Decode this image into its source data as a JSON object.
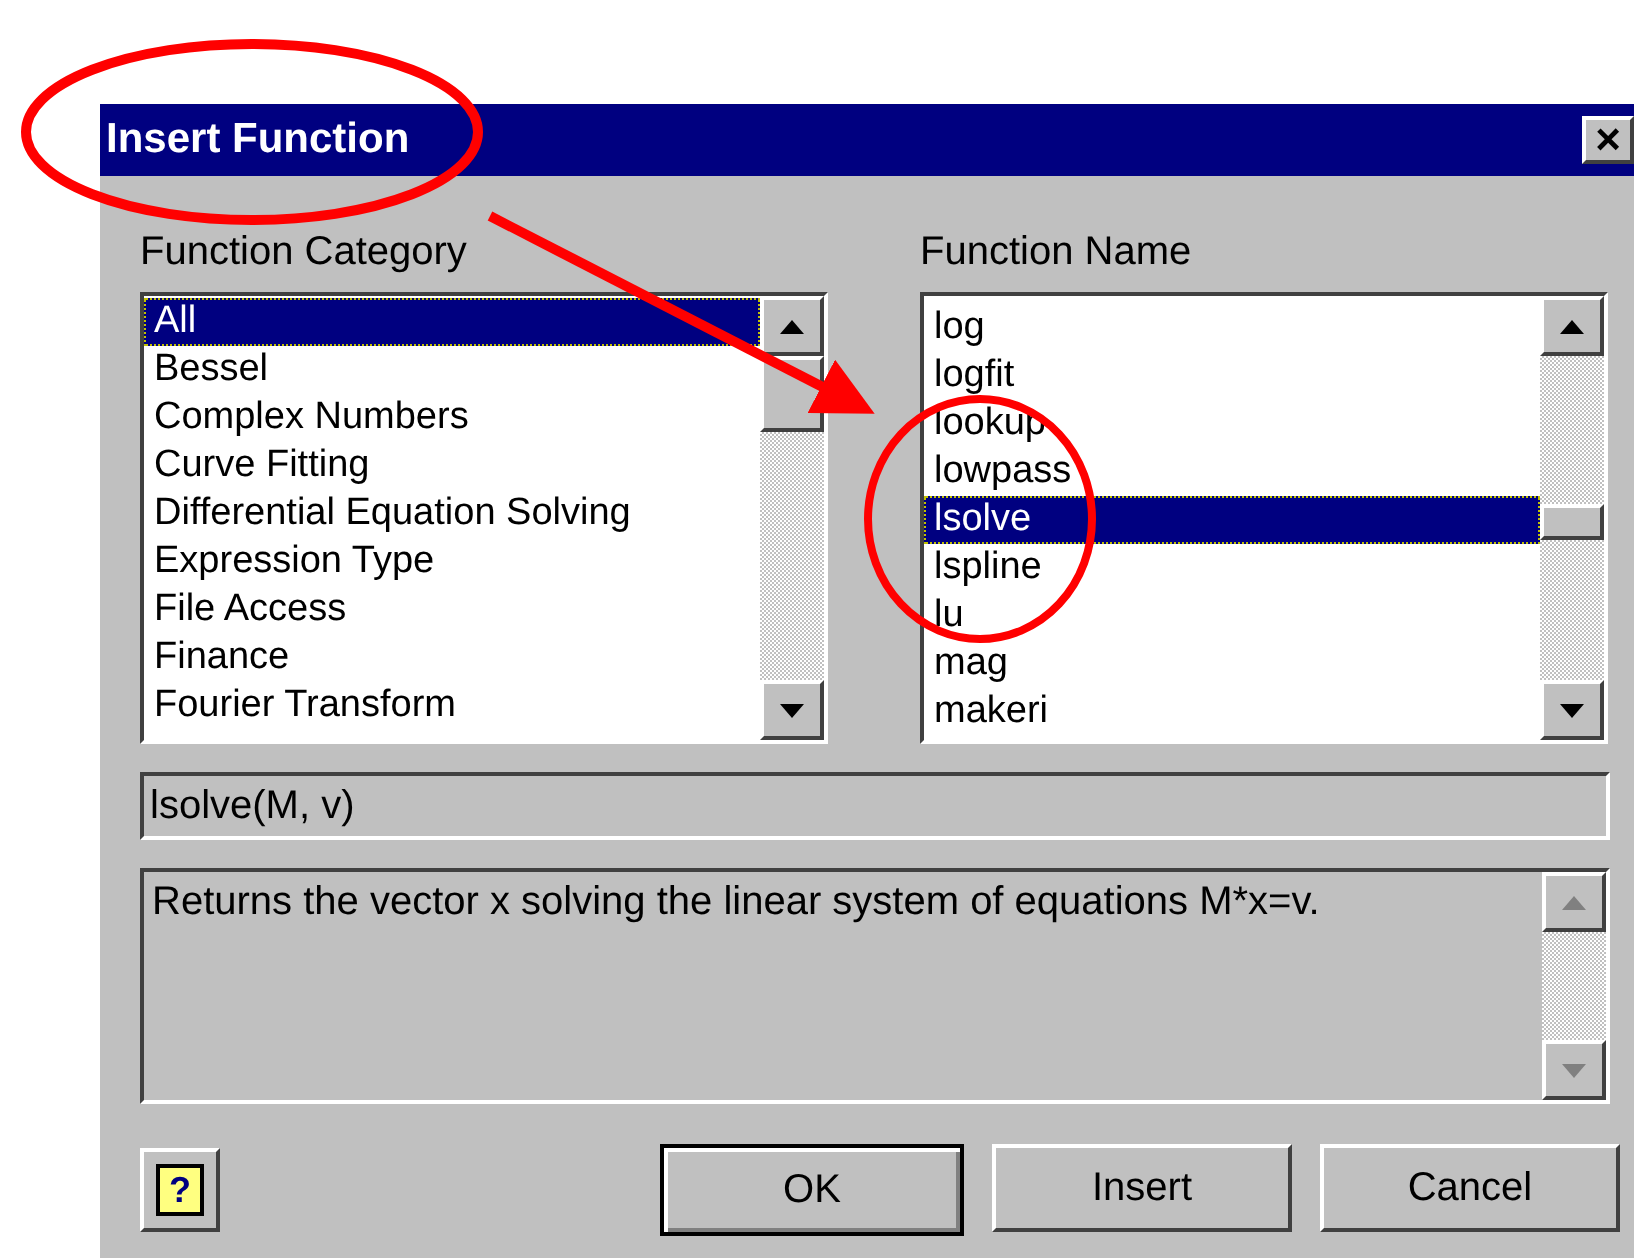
{
  "window": {
    "title": "Insert Function",
    "close": "×"
  },
  "category": {
    "label": "Function Category",
    "items": [
      {
        "label": "All",
        "selected": true
      },
      {
        "label": "Bessel",
        "selected": false
      },
      {
        "label": "Complex Numbers",
        "selected": false
      },
      {
        "label": "Curve Fitting",
        "selected": false
      },
      {
        "label": "Differential Equation Solving",
        "selected": false
      },
      {
        "label": "Expression Type",
        "selected": false
      },
      {
        "label": "File Access",
        "selected": false
      },
      {
        "label": "Finance",
        "selected": false
      },
      {
        "label": "Fourier Transform",
        "selected": false
      }
    ]
  },
  "name": {
    "label": "Function Name",
    "items": [
      {
        "label": "log",
        "selected": false
      },
      {
        "label": "logfit",
        "selected": false
      },
      {
        "label": "lookup",
        "selected": false
      },
      {
        "label": "lowpass",
        "selected": false
      },
      {
        "label": "lsolve",
        "selected": true
      },
      {
        "label": "lspline",
        "selected": false
      },
      {
        "label": "lu",
        "selected": false
      },
      {
        "label": "mag",
        "selected": false
      },
      {
        "label": "makeri",
        "selected": false
      }
    ]
  },
  "syntax": "lsolve(M, v)",
  "description": "Returns the vector x solving the linear system of equations M*x=v.",
  "buttons": [
    {
      "label": "OK",
      "default": true
    },
    {
      "label": "Insert",
      "default": false
    },
    {
      "label": "Cancel",
      "default": false
    }
  ],
  "help": "?"
}
